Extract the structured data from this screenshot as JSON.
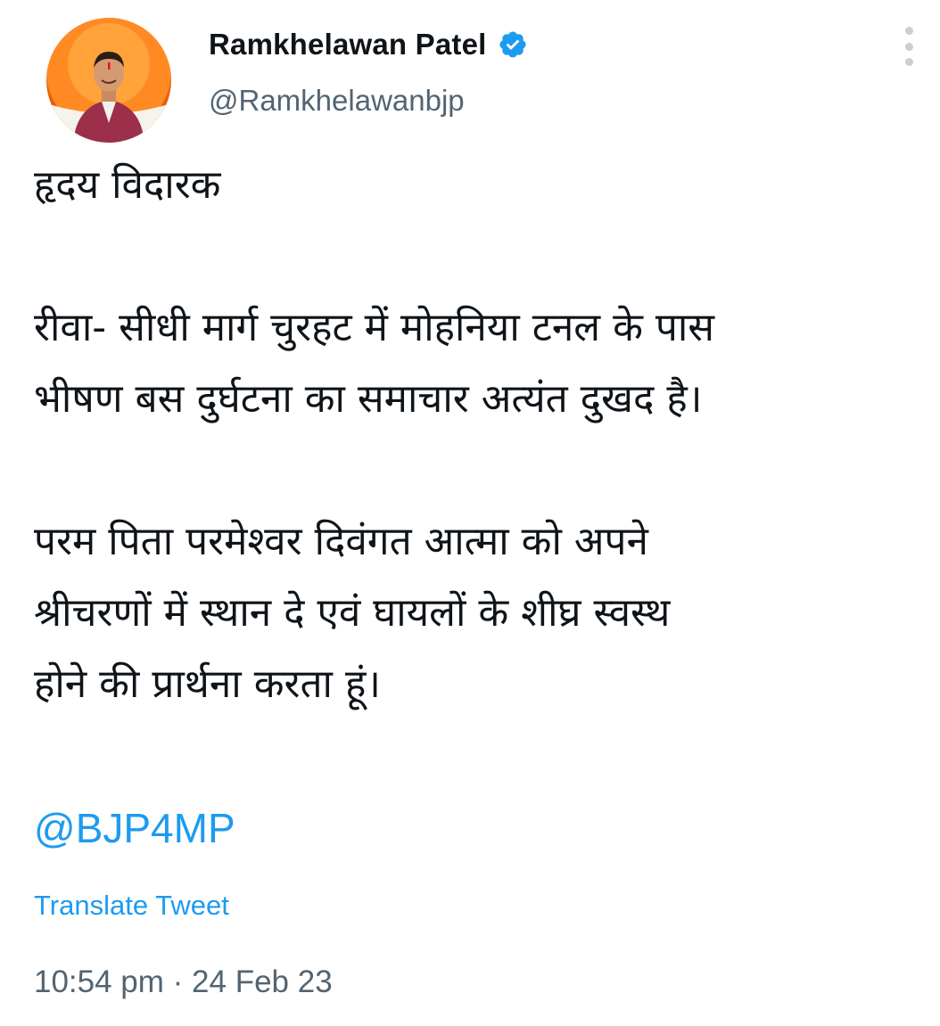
{
  "author": {
    "display_name": "Ramkhelawan Patel",
    "handle": "@Ramkhelawanbjp",
    "verified": true,
    "avatar_icon": "profile-photo",
    "verified_icon": "verified-badge-icon"
  },
  "menu": {
    "icon": "more-options-icon"
  },
  "tweet": {
    "paragraphs": [
      [
        "हृदय विदारक"
      ],
      [
        "रीवा- सीधी मार्ग चुरहट में मोहनिया टनल के पास",
        "भीषण बस दुर्घटना  का समाचार अत्यंत दुखद है।"
      ],
      [
        "परम पिता परमेश्वर दिवंगत आत्मा को अपने",
        "श्रीचरणों में स्थान दे एवं घायलों के शीघ्र स्वस्थ",
        "होने की प्रार्थना करता हूं।"
      ]
    ],
    "mention": "@BJP4MP",
    "translate_label": "Translate Tweet",
    "timestamp": "10:54 pm · 24 Feb 23"
  },
  "colors": {
    "link": "#1d9bf0",
    "secondary_text": "#536471",
    "primary_text": "#0f1419",
    "verified": "#1d9bf0",
    "avatar_bg": "#ff7a1a"
  }
}
